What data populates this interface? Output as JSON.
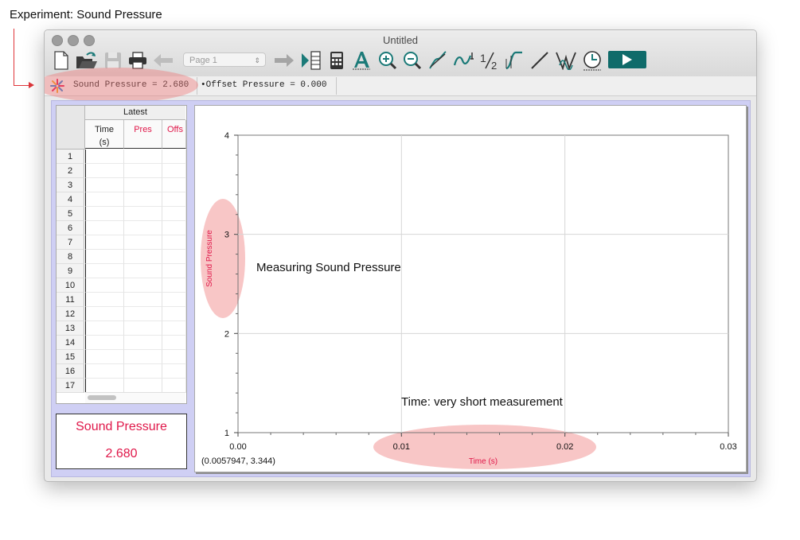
{
  "annotation": {
    "experiment_label": "Experiment: Sound Pressure"
  },
  "window": {
    "title": "Untitled"
  },
  "toolbar": {
    "page_select": "Page 1",
    "buttons": [
      "new-file-icon",
      "open-file-icon",
      "save-icon",
      "print-icon",
      "back-arrow-icon",
      "forward-arrow-icon",
      "table-graph-icon",
      "calculator-icon",
      "text-annotation-icon",
      "zoom-in-icon",
      "zoom-out-icon",
      "tangent-icon",
      "curve-fit-icon",
      "half-icon",
      "linear-fit-icon",
      "line-icon",
      "peak-icon",
      "clock-icon",
      "collect-button"
    ]
  },
  "meters": {
    "sound_pressure": "Sound Pressure = 2.680",
    "offset_pressure": "•Offset Pressure = 0.000"
  },
  "table": {
    "group_header": "Latest",
    "columns": [
      {
        "label": "Time",
        "unit": "(s)"
      },
      {
        "label": "Pres",
        "unit": ""
      },
      {
        "label": "Offs",
        "unit": ""
      }
    ],
    "row_numbers": [
      "1",
      "2",
      "3",
      "4",
      "5",
      "6",
      "7",
      "8",
      "9",
      "10",
      "11",
      "12",
      "13",
      "14",
      "15",
      "16",
      "17"
    ]
  },
  "digital_meter": {
    "label": "Sound Pressure",
    "value": "2.680"
  },
  "graph": {
    "ylabel": "Sound Pressure",
    "xlabel": "Time (s)",
    "annotation_main": "Measuring Sound Pressure",
    "annotation_time": "Time: very short measurement",
    "cursor_readout": "(0.0057947, 3.344)",
    "x_ticks": [
      "0.00",
      "0.01",
      "0.02",
      "0.03"
    ],
    "y_ticks": [
      "1",
      "2",
      "3",
      "4"
    ]
  },
  "colors": {
    "accent_red": "#e0184a",
    "highlight": "#ee7878",
    "graph_frame": "#cfcff4",
    "run_button": "#0f6b6a"
  },
  "chart_data": {
    "type": "line",
    "title": "",
    "xlabel": "Time (s)",
    "ylabel": "Sound Pressure",
    "xlim": [
      0,
      0.03
    ],
    "ylim": [
      1,
      4
    ],
    "x_ticks": [
      0,
      0.01,
      0.02,
      0.03
    ],
    "y_ticks": [
      1,
      2,
      3,
      4
    ],
    "grid": true,
    "series": []
  }
}
